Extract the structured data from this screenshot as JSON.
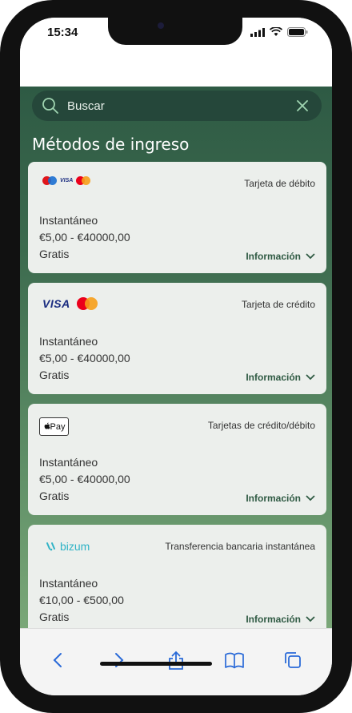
{
  "status": {
    "time": "15:34"
  },
  "search": {
    "placeholder": "Buscar"
  },
  "section_title": "Métodos de ingreso",
  "methods": [
    {
      "type_label": "Tarjeta de débito",
      "speed": "Instantáneo",
      "range": "€5,00 - €40000,00",
      "fee": "Gratis",
      "info_label": "Información",
      "logo": "maestro-visa-mastercard"
    },
    {
      "type_label": "Tarjeta de crédito",
      "speed": "Instantáneo",
      "range": "€5,00 - €40000,00",
      "fee": "Gratis",
      "info_label": "Información",
      "logo": "visa-mastercard",
      "logo_text": "VISA"
    },
    {
      "type_label": "Tarjetas de crédito/débito",
      "speed": "Instantáneo",
      "range": "€5,00 - €40000,00",
      "fee": "Gratis",
      "info_label": "Información",
      "logo": "apple-pay",
      "logo_text": "Pay"
    },
    {
      "type_label": "Transferencia bancaria instantánea",
      "speed": "Instantáneo",
      "range": "€10,00 - €500,00",
      "fee": "Gratis",
      "info_label": "Información",
      "logo": "bizum",
      "logo_text": "bizum"
    }
  ],
  "colors": {
    "accent": "#2f5a43",
    "background": "#3c6a4e",
    "card": "#ecefec",
    "bizum": "#2fb3c6"
  },
  "toolbar": {
    "icons": [
      "back-icon",
      "forward-icon",
      "share-icon",
      "bookmarks-icon",
      "tabs-icon"
    ]
  }
}
